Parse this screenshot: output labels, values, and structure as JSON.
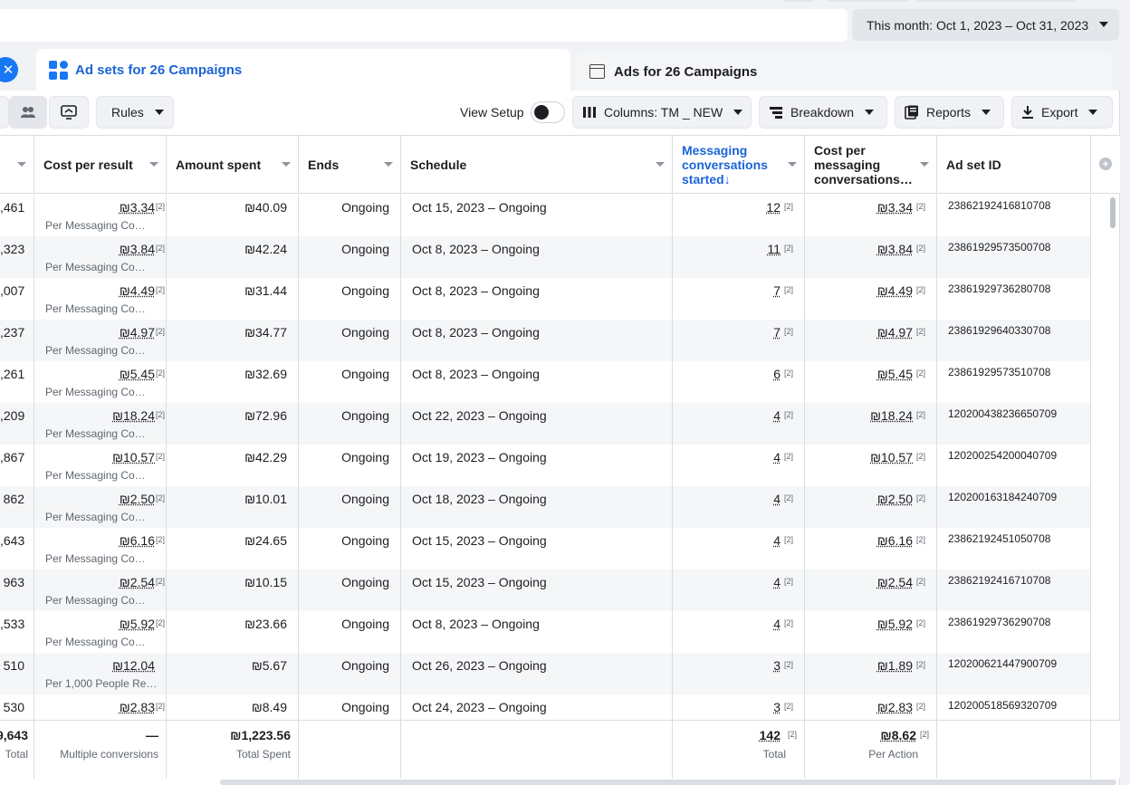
{
  "header": {
    "date_range": "This month: Oct 1, 2023 – Oct 31, 2023"
  },
  "tabs": {
    "active_label": "Ad sets for 26 Campaigns",
    "inactive_label": "Ads for 26 Campaigns"
  },
  "toolbar": {
    "rules": "Rules",
    "view_setup": "View Setup",
    "columns": "Columns: TM _ NEW",
    "breakdown": "Breakdown",
    "reports": "Reports",
    "export": "Export"
  },
  "columns": {
    "cost_per_result": "Cost per result",
    "amount_spent": "Amount spent",
    "ends": "Ends",
    "schedule": "Schedule",
    "messaging_started": "Messaging conversations started",
    "cost_per_messaging": "Cost per messaging conversations…",
    "ad_set_id": "Ad set ID"
  },
  "footnote": "[2]",
  "rows": [
    {
      "reach": ",461",
      "cost": "₪3.34",
      "cost_sub": "Per Messaging Co…",
      "spent": "₪40.09",
      "ends": "Ongoing",
      "schedule": "Oct 15, 2023 – Ongoing",
      "msgs": "12",
      "cpm": "₪3.34",
      "id": "23862192416810708"
    },
    {
      "reach": ",323",
      "cost": "₪3.84",
      "cost_sub": "Per Messaging Co…",
      "spent": "₪42.24",
      "ends": "Ongoing",
      "schedule": "Oct 8, 2023 – Ongoing",
      "msgs": "11",
      "cpm": "₪3.84",
      "id": "23861929573500708"
    },
    {
      "reach": ",007",
      "cost": "₪4.49",
      "cost_sub": "Per Messaging Co…",
      "spent": "₪31.44",
      "ends": "Ongoing",
      "schedule": "Oct 8, 2023 – Ongoing",
      "msgs": "7",
      "cpm": "₪4.49",
      "id": "23861929736280708"
    },
    {
      "reach": ",237",
      "cost": "₪4.97",
      "cost_sub": "Per Messaging Co…",
      "spent": "₪34.77",
      "ends": "Ongoing",
      "schedule": "Oct 8, 2023 – Ongoing",
      "msgs": "7",
      "cpm": "₪4.97",
      "id": "23861929640330708"
    },
    {
      "reach": ",261",
      "cost": "₪5.45",
      "cost_sub": "Per Messaging Co…",
      "spent": "₪32.69",
      "ends": "Ongoing",
      "schedule": "Oct 8, 2023 – Ongoing",
      "msgs": "6",
      "cpm": "₪5.45",
      "id": "23861929573510708"
    },
    {
      "reach": ",209",
      "cost": "₪18.24",
      "cost_sub": "Per Messaging Co…",
      "spent": "₪72.96",
      "ends": "Ongoing",
      "schedule": "Oct 22, 2023 – Ongoing",
      "msgs": "4",
      "cpm": "₪18.24",
      "id": "120200438236650709"
    },
    {
      "reach": ",867",
      "cost": "₪10.57",
      "cost_sub": "Per Messaging Co…",
      "spent": "₪42.29",
      "ends": "Ongoing",
      "schedule": "Oct 19, 2023 – Ongoing",
      "msgs": "4",
      "cpm": "₪10.57",
      "id": "120200254200040709"
    },
    {
      "reach": "862",
      "cost": "₪2.50",
      "cost_sub": "Per Messaging Co…",
      "spent": "₪10.01",
      "ends": "Ongoing",
      "schedule": "Oct 18, 2023 – Ongoing",
      "msgs": "4",
      "cpm": "₪2.50",
      "id": "120200163184240709"
    },
    {
      "reach": ",643",
      "cost": "₪6.16",
      "cost_sub": "Per Messaging Co…",
      "spent": "₪24.65",
      "ends": "Ongoing",
      "schedule": "Oct 15, 2023 – Ongoing",
      "msgs": "4",
      "cpm": "₪6.16",
      "id": "23862192451050708"
    },
    {
      "reach": "963",
      "cost": "₪2.54",
      "cost_sub": "Per Messaging Co…",
      "spent": "₪10.15",
      "ends": "Ongoing",
      "schedule": "Oct 15, 2023 – Ongoing",
      "msgs": "4",
      "cpm": "₪2.54",
      "id": "23862192416710708"
    },
    {
      "reach": ",533",
      "cost": "₪5.92",
      "cost_sub": "Per Messaging Co…",
      "spent": "₪23.66",
      "ends": "Ongoing",
      "schedule": "Oct 8, 2023 – Ongoing",
      "msgs": "4",
      "cpm": "₪5.92",
      "id": "23861929736290708"
    },
    {
      "reach": "510",
      "cost": "₪12.04",
      "cost_sub": "Per 1,000 People Re…",
      "spent": "₪5.67",
      "ends": "Ongoing",
      "schedule": "Oct 26, 2023 – Ongoing",
      "msgs": "3",
      "cpm": "₪1.89",
      "id": "120200621447900709"
    },
    {
      "reach": "530",
      "cost": "₪2.83",
      "cost_sub": "",
      "spent": "₪8.49",
      "ends": "Ongoing",
      "schedule": "Oct 24, 2023 – Ongoing",
      "msgs": "3",
      "cpm": "₪2.83",
      "id": "120200518569320709"
    }
  ],
  "totals": {
    "reach": "9,643",
    "reach_label": "Total",
    "cost": "—",
    "cost_label": "Multiple conversions",
    "spent": "₪1,223.56",
    "spent_label": "Total Spent",
    "msgs": "142",
    "msgs_label": "Total",
    "cpm": "₪8.62",
    "cpm_label": "Per Action"
  },
  "colors": {
    "accent": "#1877f2",
    "link_blue": "#1b64d8"
  }
}
